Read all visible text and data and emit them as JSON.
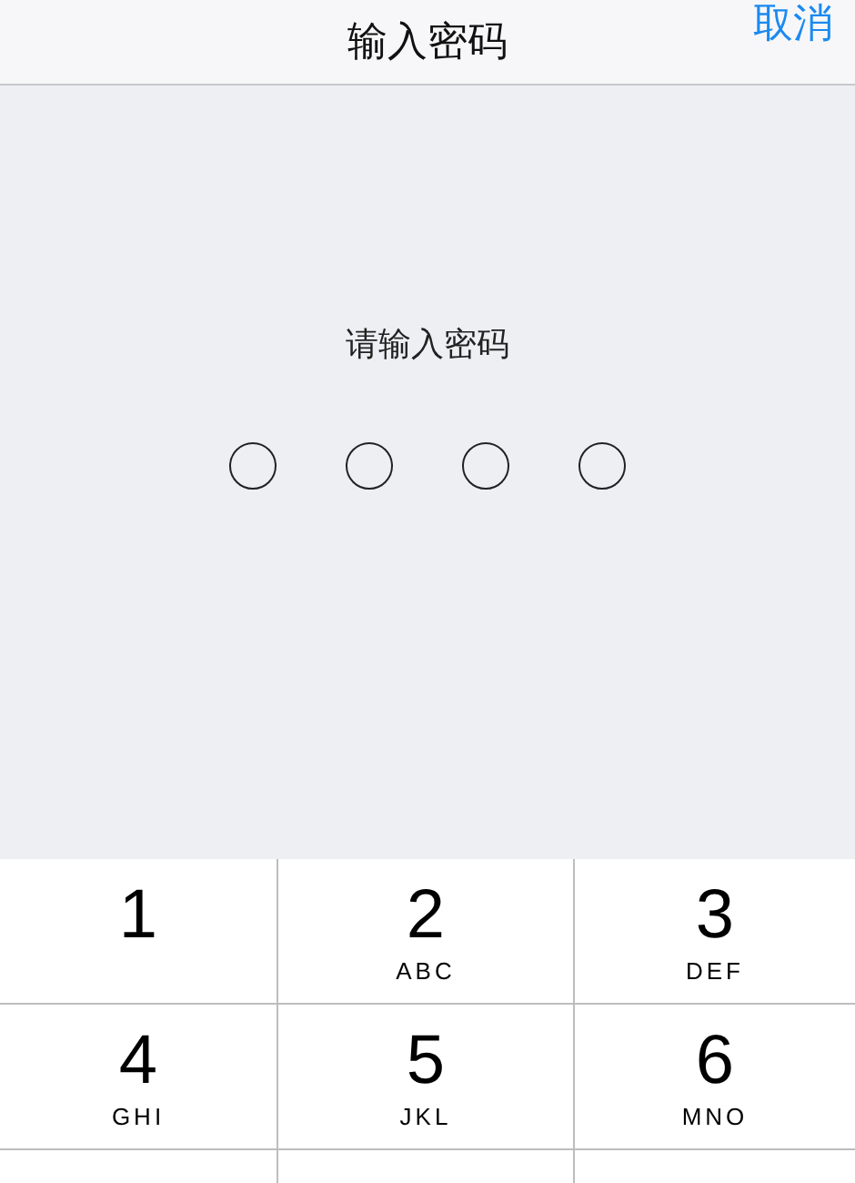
{
  "nav_bar": {
    "title": "输入密码",
    "cancel": "取消"
  },
  "prompt": "请输入密码",
  "passcode_dots": [
    {
      "filled": false
    },
    {
      "filled": false
    },
    {
      "filled": false
    },
    {
      "filled": false
    }
  ],
  "keypad": [
    {
      "digit": "1"
    },
    {
      "digit": "2",
      "letters": "ABC"
    },
    {
      "digit": "3",
      "letters": "DEF"
    },
    {
      "digit": "4",
      "letters": "GHI"
    },
    {
      "digit": "5",
      "letters": "JKL"
    },
    {
      "digit": "6",
      "letters": "MNO"
    }
  ]
}
